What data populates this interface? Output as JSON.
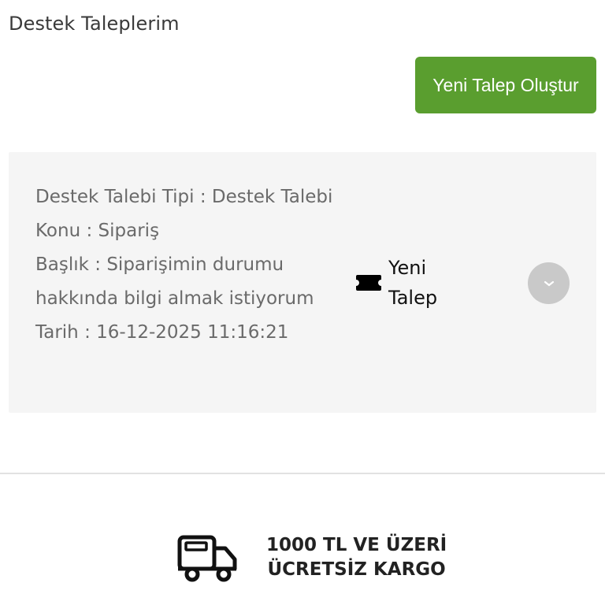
{
  "header": {
    "title": "Destek Taleplerim"
  },
  "actions": {
    "new_ticket_label": "Yeni Talep Oluştur"
  },
  "ticket": {
    "type_line": "Destek Talebi Tipi : Destek Talebi",
    "subject_line": "Konu : Sipariş",
    "title_line": "Başlık : Siparişimin durumu hakkında bilgi almak istiyorum",
    "date_line": "Tarih : 16-12-2025 11:16:21",
    "status": "Yeni Talep",
    "status_icon": "ticket-icon",
    "expand_icon": "chevron-down-icon"
  },
  "footer": {
    "shipping_icon": "truck-icon",
    "shipping_line1": "1000 TL VE ÜZERİ",
    "shipping_line2": "ÜCRETSİZ KARGO"
  },
  "colors": {
    "primary_button": "#5a9e2f",
    "card_background": "#f5f5f5",
    "expand_button": "#c9c9c9"
  }
}
